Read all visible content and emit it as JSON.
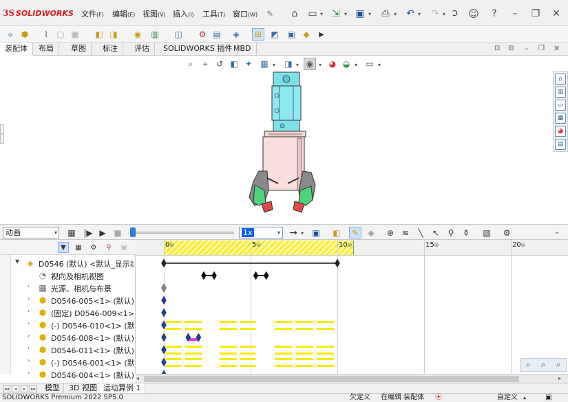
{
  "app": {
    "logo_ds": "3S",
    "logo_text": "SOLIDWORKS",
    "menu": [
      {
        "label": "文件",
        "key": "(F)"
      },
      {
        "label": "编辑",
        "key": "(E)"
      },
      {
        "label": "视图",
        "key": "(V)"
      },
      {
        "label": "插入",
        "key": "(I)"
      },
      {
        "label": "工具",
        "key": "(T)"
      },
      {
        "label": "窗口",
        "key": "(W)"
      }
    ],
    "search_placeholder": "Ͻ"
  },
  "command_tabs": [
    "装配体",
    "布局",
    "草图",
    "标注",
    "评估",
    "SOLIDWORKS 插件",
    "MBD"
  ],
  "active_command_tab": 0,
  "motion": {
    "study_type": "动画",
    "speed": "1x",
    "slider_position": 0.0
  },
  "tree": {
    "rows": [
      {
        "label": "D0546 (默认) <默认_显示状态",
        "indent": 0,
        "expander": "▼",
        "icon": "assembly-icon"
      },
      {
        "label": "视向及相机视图",
        "indent": 1,
        "expander": "",
        "icon": "camera-icon"
      },
      {
        "label": "光源、相机与布景",
        "indent": 1,
        "expander": "›",
        "icon": "lights-icon"
      },
      {
        "label": "D0546-005<1> (默认) <<",
        "indent": 1,
        "expander": "›",
        "icon": "part-icon"
      },
      {
        "label": "(固定) D0546-009<1> (默",
        "indent": 1,
        "expander": "›",
        "icon": "part-icon"
      },
      {
        "label": "(-) D0546-010<1> (默认)",
        "indent": 1,
        "expander": "›",
        "icon": "part-icon"
      },
      {
        "label": "D0546-008<1> (默认) <<",
        "indent": 1,
        "expander": "›",
        "icon": "part-icon"
      },
      {
        "label": "D0546-011<1> (默认) <<",
        "indent": 1,
        "expander": "›",
        "icon": "part-icon"
      },
      {
        "label": "(-) D0546-001<1> (默认)",
        "indent": 1,
        "expander": "›",
        "icon": "part-icon"
      },
      {
        "label": "D0546-004<1> (默认)",
        "indent": 1,
        "expander": "›",
        "icon": "part-icon"
      }
    ]
  },
  "timeline": {
    "ticks": [
      {
        "label": "0",
        "seconds": 0
      },
      {
        "label": "5",
        "seconds": 5
      },
      {
        "label": "10",
        "seconds": 10
      },
      {
        "label": "15",
        "seconds": 15
      },
      {
        "label": "20",
        "seconds": 20
      }
    ],
    "key_seconds": 10
  },
  "bottom_tabs": [
    "模型",
    "3D 视图",
    "运动算例 1"
  ],
  "active_bottom_tab": 2,
  "status": {
    "product": "SOLIDWORKS Premium 2022 SP5.0",
    "definition": "欠定义",
    "mode": "在编辑 装配体",
    "custom": "自定义"
  }
}
